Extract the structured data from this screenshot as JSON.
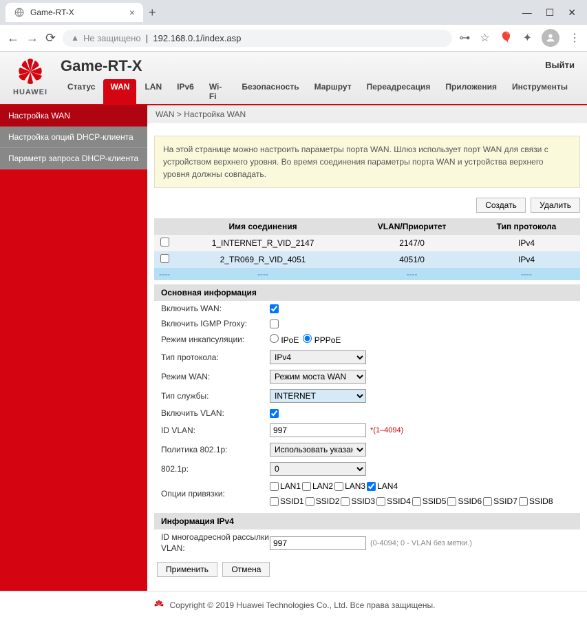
{
  "browser": {
    "tab_title": "Game-RT-X",
    "addr_not_secure": "Не защищено",
    "url": "192.168.0.1/index.asp"
  },
  "header": {
    "brand": "HUAWEI",
    "title": "Game-RT-X",
    "logout": "Выйти",
    "tabs": [
      "Статус",
      "WAN",
      "LAN",
      "IPv6",
      "Wi-Fi",
      "Безопасность",
      "Маршрут",
      "Переадресация",
      "Приложения",
      "Инструменты"
    ],
    "active_tab": 1
  },
  "sidebar": {
    "items": [
      {
        "label": "Настройка WAN",
        "active": true
      },
      {
        "label": "Настройка опций DHCP-клиента",
        "active": false
      },
      {
        "label": "Параметр запроса DHCP-клиента",
        "active": false
      }
    ]
  },
  "breadcrumb": "WAN > Настройка WAN",
  "info_text": "На этой странице можно настроить параметры порта WAN. Шлюз использует порт WAN для связи с устройством верхнего уровня. Во время соединения параметры порта WAN и устройства верхнего уровня должны совпадать.",
  "buttons": {
    "create": "Создать",
    "delete": "Удалить",
    "apply": "Применить",
    "cancel": "Отмена"
  },
  "table": {
    "headers": [
      "Имя соединения",
      "VLAN/Приоритет",
      "Тип протокола"
    ],
    "rows": [
      {
        "name": "1_INTERNET_R_VID_2147",
        "vlan": "2147/0",
        "proto": "IPv4"
      },
      {
        "name": "2_TR069_R_VID_4051",
        "vlan": "4051/0",
        "proto": "IPv4"
      }
    ],
    "sep": "----"
  },
  "sections": {
    "basic": "Основная информация",
    "ipv4": "Информация IPv4"
  },
  "form": {
    "enable_wan": {
      "label": "Включить WAN:",
      "checked": true
    },
    "igmp": {
      "label": "Включить IGMP Proxy:",
      "checked": false
    },
    "encap": {
      "label": "Режим инкапсуляции:",
      "opts": [
        "IPoE",
        "PPPoE"
      ],
      "selected": "PPPoE"
    },
    "proto": {
      "label": "Тип протокола:",
      "value": "IPv4"
    },
    "wan_mode": {
      "label": "Режим WAN:",
      "value": "Режим моста WAN"
    },
    "service": {
      "label": "Тип службы:",
      "value": "INTERNET"
    },
    "enable_vlan": {
      "label": "Включить VLAN:",
      "checked": true
    },
    "vlan_id": {
      "label": "ID VLAN:",
      "value": "997",
      "hint": "*(1–4094)"
    },
    "policy": {
      "label": "Политика 802.1p:",
      "value": "Использовать указанное"
    },
    "p8021": {
      "label": "802.1p:",
      "value": "0"
    },
    "bind": {
      "label": "Опции привязки:",
      "lans": [
        "LAN1",
        "LAN2",
        "LAN3",
        "LAN4"
      ],
      "lan_checked": 3,
      "ssids": [
        "SSID1",
        "SSID2",
        "SSID3",
        "SSID4",
        "SSID5",
        "SSID6",
        "SSID7",
        "SSID8"
      ]
    },
    "multicast": {
      "label": "ID многоадресной рассылки VLAN:",
      "value": "997",
      "hint": "(0-4094; 0 - VLAN без метки.)"
    }
  },
  "footer": "Copyright © 2019 Huawei Technologies Co., Ltd. Все права защищены."
}
